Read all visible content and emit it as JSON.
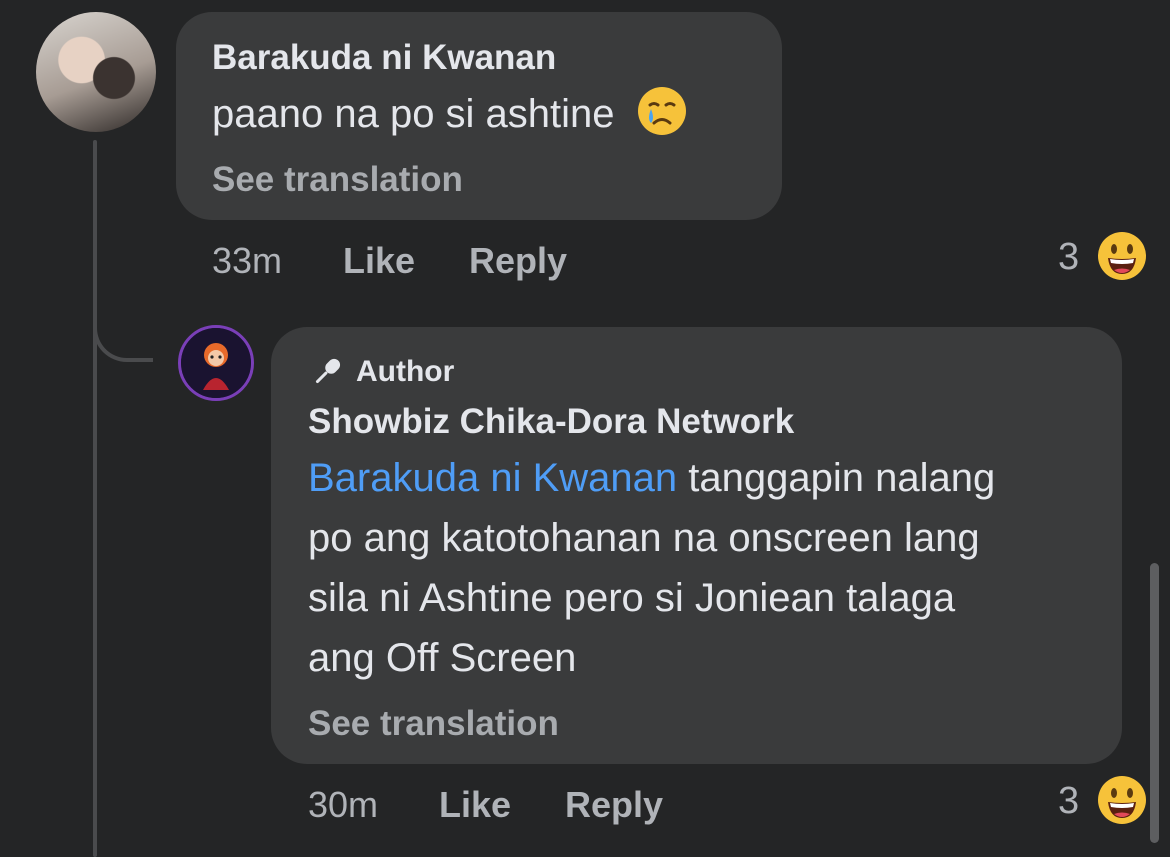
{
  "comments": [
    {
      "author": "Barakuda ni Kwanan",
      "text": "paano na po si ashtine",
      "emoji": "crying-face",
      "see_translation": "See translation",
      "time": "33m",
      "like_label": "Like",
      "reply_label": "Reply",
      "reaction_count": "3",
      "reaction_emoji": "grinning-face"
    },
    {
      "badge": "Author",
      "author": "Showbiz Chika-Dora Network",
      "mention": "Barakuda ni Kwanan",
      "lines": [
        "tanggapin nalang",
        "po ang katotohanan na onscreen lang",
        "sila ni Ashtine pero si Joniean talaga",
        "ang Off Screen"
      ],
      "see_translation": "See translation",
      "time": "30m",
      "like_label": "Like",
      "reply_label": "Reply",
      "reaction_count": "3",
      "reaction_emoji": "grinning-face"
    }
  ],
  "colors": {
    "background": "#242526",
    "bubble": "#3a3b3c",
    "mention": "#4f9df6",
    "muted": "#b0b3b8"
  }
}
